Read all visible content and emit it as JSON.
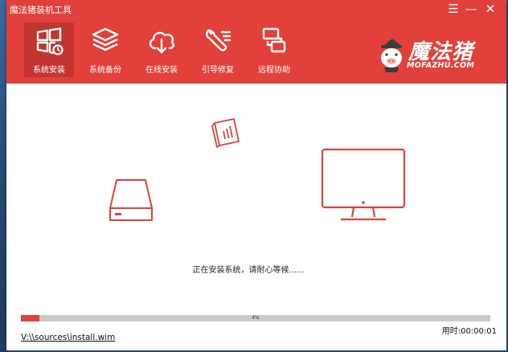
{
  "window": {
    "title": "魔法猪装机工具",
    "controls": [
      "menu-icon",
      "minimize-icon",
      "close-icon"
    ]
  },
  "nav": {
    "items": [
      {
        "label": "系统安装",
        "icon": "windows-icon",
        "active": true
      },
      {
        "label": "系统备份",
        "icon": "layers-icon",
        "active": false
      },
      {
        "label": "在线安装",
        "icon": "cloud-download-icon",
        "active": false
      },
      {
        "label": "引导修复",
        "icon": "wrench-icon",
        "active": false
      },
      {
        "label": "远程协助",
        "icon": "remote-icon",
        "active": false
      }
    ]
  },
  "brand": {
    "name": "魔法猪",
    "domain": "MOFAZHU.COM",
    "logo": "pig-mascot-icon"
  },
  "main": {
    "status": "正在安装系统，请耐心等候......",
    "icons": [
      "document-chart-icon",
      "hard-drive-icon",
      "monitor-icon"
    ]
  },
  "progress": {
    "value": 0.04,
    "percent_label": "4%"
  },
  "footer": {
    "file_path": "V:\\\\sources\\install.wim",
    "elapsed": "用时:00:00:01"
  },
  "colors": {
    "accent": "#e2403a",
    "accent_dark": "#c23530",
    "track": "#c9c9c9"
  }
}
